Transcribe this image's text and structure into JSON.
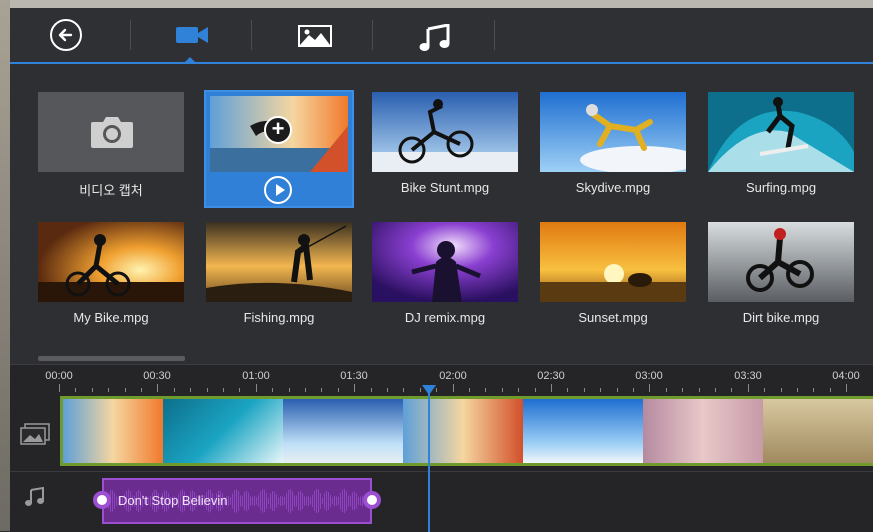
{
  "toolbar": {
    "back_icon": "back-arrow-icon",
    "tabs": [
      {
        "icon": "video-camera-icon",
        "active": true
      },
      {
        "icon": "image-icon",
        "active": false
      },
      {
        "icon": "music-note-icon",
        "active": false
      }
    ],
    "accent": "#2f82d8"
  },
  "media": {
    "capture_label": "비디오 캡처",
    "items": [
      {
        "label": "",
        "selected": true
      },
      {
        "label": "Bike Stunt.mpg"
      },
      {
        "label": "Skydive.mpg"
      },
      {
        "label": "Surfing.mpg"
      },
      {
        "label": "My Bike.mpg"
      },
      {
        "label": "Fishing.mpg"
      },
      {
        "label": "DJ remix.mpg"
      },
      {
        "label": "Sunset.mpg"
      },
      {
        "label": "Dirt bike.mpg"
      }
    ]
  },
  "timeline": {
    "ticks": [
      "00:00",
      "00:30",
      "01:00",
      "01:30",
      "02:00",
      "02:30",
      "03:00",
      "03:30",
      "04:00"
    ],
    "audio_clip_title": "Don't Stop Believin",
    "video_track_color": "#6e9b2b",
    "audio_clip_color": "#6a2c8e"
  }
}
